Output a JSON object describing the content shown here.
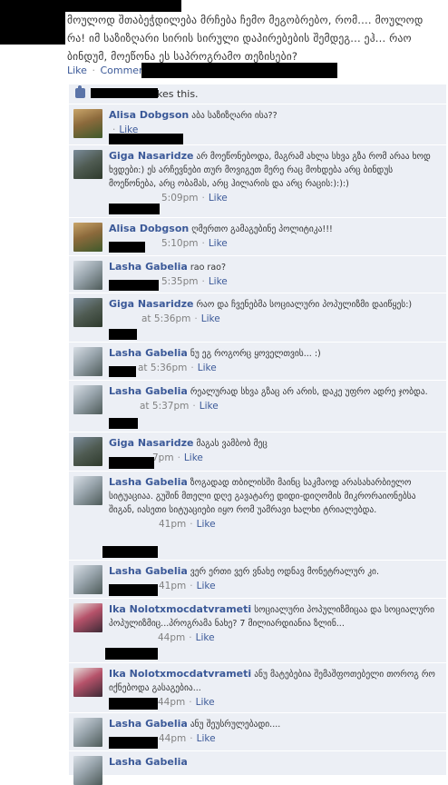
{
  "post": {
    "text": "მოულოდ შთაბეჭდილება მრჩება ჩემო მეგობრებო, რომ.... მოულოდ რა! იმ საზიზღარი სირის სირული დაპირებების შემდეგ... ეჰ... რაო ბინდუმ, მოეწონა ეს საპროგრამო თეზისები?",
    "like_label": "Like",
    "separator": "·",
    "comment_label": "Comment"
  },
  "likes": {
    "text": "kes this."
  },
  "comments": [
    {
      "name": "Alisa Dobgson",
      "text": "აბა საზიზღარი ისა??",
      "time": "",
      "like": "Like"
    },
    {
      "name": "Giga Nasaridze",
      "text": "არ მოეწონებოდა, მაგრამ ახლა სხვა გზა რომ არაა ხოდ ხვდები:) ეს არჩევნები თურ მოვიგეთ მერე რაც მოხდება არც ბინდუს მოეწონება, არც ობამას, არც ჰილარის და არც რაცის:):):)",
      "time": "5:09pm",
      "like": "Like"
    },
    {
      "name": "Alisa Dobgson",
      "text": "ღმერთო გამაგებინე პოლიტიკა!!!",
      "time": "5:10pm",
      "like": "Like"
    },
    {
      "name": "Lasha Gabelia",
      "text": "rao rao?",
      "time": "5:35pm",
      "like": "Like"
    },
    {
      "name": "Giga Nasaridze",
      "text": "რაო და ჩვენებმა სოციალური პოპულიზმი დაიწყეს:)",
      "time": "at 5:36pm",
      "like": "Like"
    },
    {
      "name": "Lasha Gabelia",
      "text": "ნუ ეგ როგორც ყოველთვის... :)",
      "time": "at 5:36pm",
      "like": "Like"
    },
    {
      "name": "Lasha Gabelia",
      "text": "რეალურად სხვა გზაც არ არის, დაკე უფრო ადრე ჯობდა.",
      "time": "at 5:37pm",
      "like": "Like"
    },
    {
      "name": "Giga Nasaridze",
      "text": "მაგას ვამბობ მეც",
      "time": "7pm",
      "like": "Like"
    },
    {
      "name": "Lasha Gabelia",
      "text": "ზოგადად თბილისში მაინც საკმაოდ არასახარბიელო სიტუაციაა. გუშინ მთელი დღე გავატარე დიდი-დიღომის მიკრორაიონებსა შიგან, იასეთი სიტუაციები იყო რომ უამრავი ხალხი ტრიალებდა.",
      "time": "41pm",
      "like": "Like"
    },
    {
      "name": "Lasha Gabelia",
      "text": "ვერ ერთი ვერ ვნახე ოდნავ მონეტრალურ კი.",
      "time": "41pm",
      "like": "Like"
    },
    {
      "name": "Ika Nolotxmocdatvrameti",
      "text": "სოციალური პოპულიზმიცაა და სოციალური პოპულიზმიც...პროგრამა ნახე? 7 მილიარდიანია ზლინ...",
      "time": "44pm",
      "like": "Like"
    },
    {
      "name": "Ika Nolotxmocdatvrameti",
      "text": "ანუ მატებებია შემაშფოთებელი თოროგ რო იქნებოდა გასაგებია...",
      "time": "44pm",
      "like": "Like"
    },
    {
      "name": "Lasha Gabelia",
      "text": "ანუ შეუსრულებადი....",
      "time": "44pm",
      "like": "Like"
    },
    {
      "name": "Lasha Gabelia",
      "text": "",
      "time": "",
      "like": ""
    }
  ]
}
